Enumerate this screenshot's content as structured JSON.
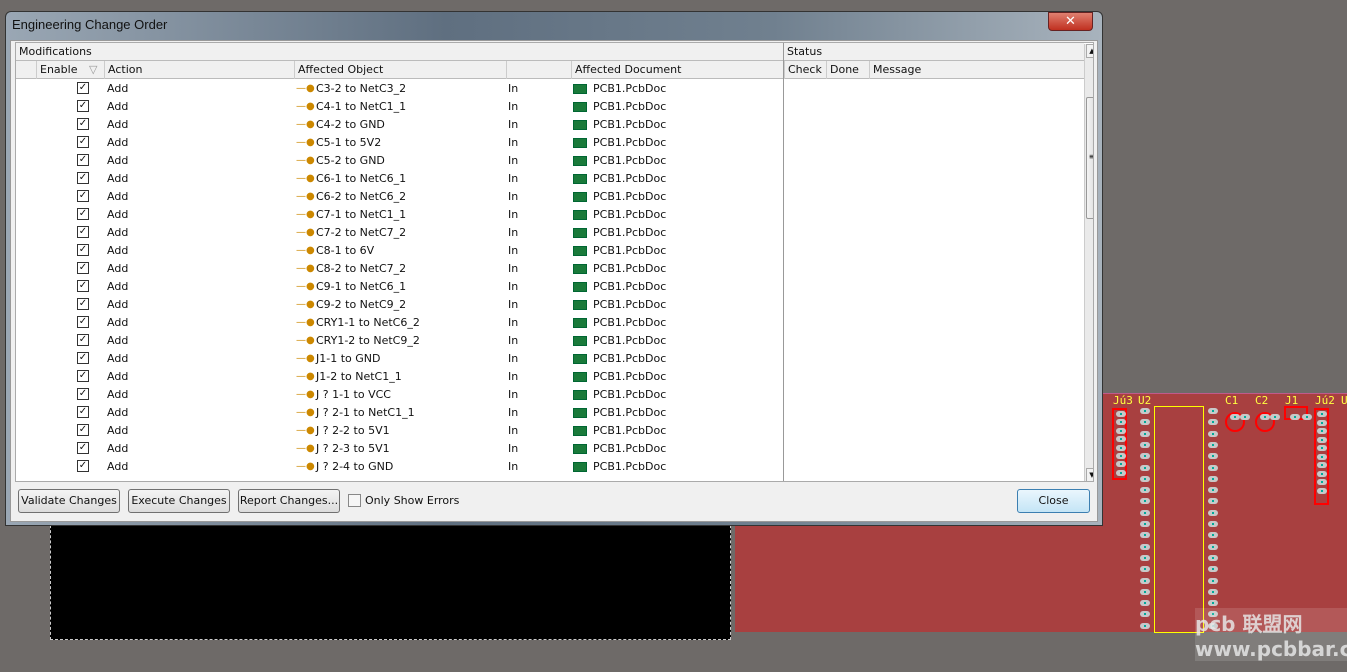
{
  "dialog": {
    "title": "Engineering Change Order",
    "close_icon": "close-icon"
  },
  "modifications": {
    "label": "Modifications",
    "columns": {
      "enable": "Enable",
      "action": "Action",
      "object": "Affected Object",
      "document": "Affected Document"
    }
  },
  "status": {
    "label": "Status",
    "columns": {
      "check": "Check",
      "done": "Done",
      "message": "Message"
    }
  },
  "rows": [
    {
      "enabled": true,
      "action": "Add",
      "object": "C3-2 to NetC3_2",
      "in": "In",
      "document": "PCB1.PcbDoc"
    },
    {
      "enabled": true,
      "action": "Add",
      "object": "C4-1 to NetC1_1",
      "in": "In",
      "document": "PCB1.PcbDoc"
    },
    {
      "enabled": true,
      "action": "Add",
      "object": "C4-2 to GND",
      "in": "In",
      "document": "PCB1.PcbDoc"
    },
    {
      "enabled": true,
      "action": "Add",
      "object": "C5-1 to 5V2",
      "in": "In",
      "document": "PCB1.PcbDoc"
    },
    {
      "enabled": true,
      "action": "Add",
      "object": "C5-2 to GND",
      "in": "In",
      "document": "PCB1.PcbDoc"
    },
    {
      "enabled": true,
      "action": "Add",
      "object": "C6-1 to NetC6_1",
      "in": "In",
      "document": "PCB1.PcbDoc"
    },
    {
      "enabled": true,
      "action": "Add",
      "object": "C6-2 to NetC6_2",
      "in": "In",
      "document": "PCB1.PcbDoc"
    },
    {
      "enabled": true,
      "action": "Add",
      "object": "C7-1 to NetC1_1",
      "in": "In",
      "document": "PCB1.PcbDoc"
    },
    {
      "enabled": true,
      "action": "Add",
      "object": "C7-2 to NetC7_2",
      "in": "In",
      "document": "PCB1.PcbDoc"
    },
    {
      "enabled": true,
      "action": "Add",
      "object": "C8-1 to 6V",
      "in": "In",
      "document": "PCB1.PcbDoc"
    },
    {
      "enabled": true,
      "action": "Add",
      "object": "C8-2 to NetC7_2",
      "in": "In",
      "document": "PCB1.PcbDoc"
    },
    {
      "enabled": true,
      "action": "Add",
      "object": "C9-1 to NetC6_1",
      "in": "In",
      "document": "PCB1.PcbDoc"
    },
    {
      "enabled": true,
      "action": "Add",
      "object": "C9-2 to NetC9_2",
      "in": "In",
      "document": "PCB1.PcbDoc"
    },
    {
      "enabled": true,
      "action": "Add",
      "object": "CRY1-1 to NetC6_2",
      "in": "In",
      "document": "PCB1.PcbDoc"
    },
    {
      "enabled": true,
      "action": "Add",
      "object": "CRY1-2 to NetC9_2",
      "in": "In",
      "document": "PCB1.PcbDoc"
    },
    {
      "enabled": true,
      "action": "Add",
      "object": "J1-1 to GND",
      "in": "In",
      "document": "PCB1.PcbDoc"
    },
    {
      "enabled": true,
      "action": "Add",
      "object": "J1-2 to NetC1_1",
      "in": "In",
      "document": "PCB1.PcbDoc"
    },
    {
      "enabled": true,
      "action": "Add",
      "object": "J ? 1-1 to VCC",
      "in": "In",
      "document": "PCB1.PcbDoc"
    },
    {
      "enabled": true,
      "action": "Add",
      "object": "J ? 2-1 to NetC1_1",
      "in": "In",
      "document": "PCB1.PcbDoc"
    },
    {
      "enabled": true,
      "action": "Add",
      "object": "J ? 2-2 to 5V1",
      "in": "In",
      "document": "PCB1.PcbDoc"
    },
    {
      "enabled": true,
      "action": "Add",
      "object": "J ? 2-3 to 5V1",
      "in": "In",
      "document": "PCB1.PcbDoc"
    },
    {
      "enabled": true,
      "action": "Add",
      "object": "J ? 2-4 to GND",
      "in": "In",
      "document": "PCB1.PcbDoc"
    }
  ],
  "buttons": {
    "validate": "Validate Changes",
    "execute": "Execute Changes",
    "report": "Report Changes...",
    "close": "Close"
  },
  "only_show_errors": {
    "label": "Only Show Errors",
    "checked": false
  },
  "pcb": {
    "labels": [
      "Jú3",
      "U2",
      "C1",
      "C2",
      "J1",
      "Jú2",
      "U"
    ],
    "watermark": "pcb 联盟网 www.pcbbar.com",
    "board_color": "#a84040"
  }
}
